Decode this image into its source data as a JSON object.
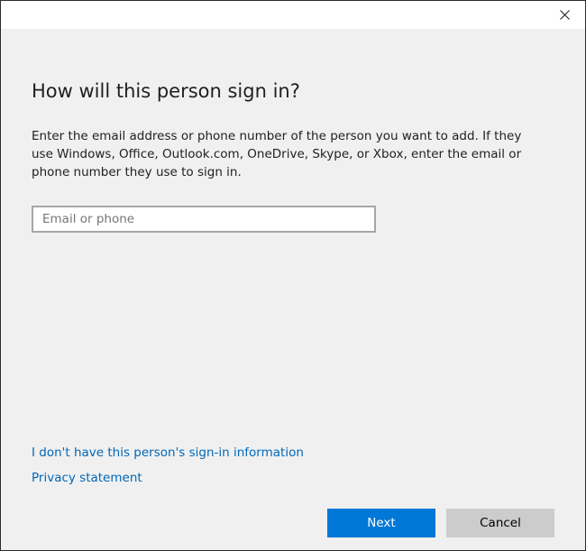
{
  "titlebar": {
    "close_icon": "close-icon"
  },
  "dialog": {
    "heading": "How will this person sign in?",
    "description": "Enter the email address or phone number of the person you want to add. If they use Windows, Office, Outlook.com, OneDrive, Skype, or Xbox, enter the email or phone number they use to sign in.",
    "input": {
      "placeholder": "Email or phone",
      "value": ""
    },
    "links": {
      "no_info": "I don't have this person's sign-in information",
      "privacy": "Privacy statement"
    },
    "buttons": {
      "next": "Next",
      "cancel": "Cancel"
    }
  },
  "colors": {
    "accent": "#0078d7",
    "link": "#0067b8",
    "background": "#f0f0f0",
    "secondary_button": "#cccccc"
  }
}
